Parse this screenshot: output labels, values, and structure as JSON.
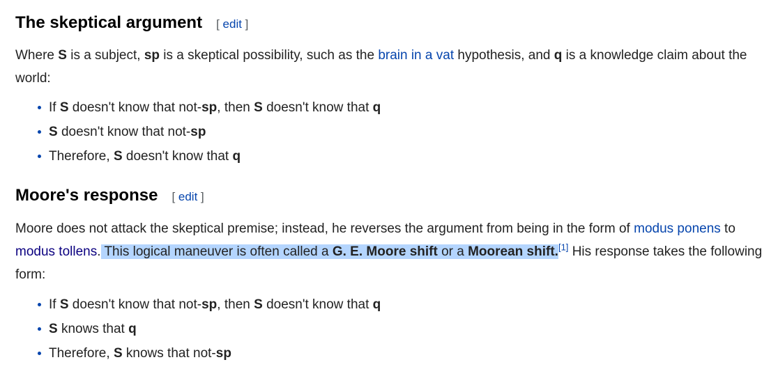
{
  "section1": {
    "heading": "The skeptical argument",
    "edit_open": "[ ",
    "edit_label": "edit",
    "edit_close": " ]",
    "para": {
      "t1": "Where ",
      "S": "S",
      "t2": " is a subject, ",
      "sp": "sp",
      "t3": " is a skeptical possibility, such as the ",
      "link": "brain in a vat",
      "t4": " hypothesis, and ",
      "q": "q",
      "t5": " is a knowledge claim about the world:"
    },
    "bullets": [
      {
        "a": "If ",
        "b1": "S",
        "c": " doesn't know that not-",
        "b2": "sp",
        "d": ", then ",
        "b3": "S",
        "e": " doesn't know that ",
        "b4": "q"
      },
      {
        "b1": "S",
        "c": " doesn't know that not-",
        "b2": "sp"
      },
      {
        "a": "Therefore, ",
        "b1": "S",
        "c": " doesn't know that ",
        "b2": "q"
      }
    ]
  },
  "section2": {
    "heading": "Moore's response",
    "edit_open": "[ ",
    "edit_label": "edit",
    "edit_close": " ]",
    "para": {
      "t1": "Moore does not attack the skeptical premise; instead, he reverses the argument from being in the form of ",
      "link1": "modus ponens",
      "t2": " to ",
      "link2": "modus tollens",
      "t3": ".",
      "h1": " This logical maneuver is often called a ",
      "hb1": "G. E. Moore shift",
      "h2": " or a ",
      "hb2": "Moorean shift.",
      "ref": "[1]",
      "t4": " His response takes the following form:"
    },
    "bullets": [
      {
        "a": "If ",
        "b1": "S",
        "c": " doesn't know that not-",
        "b2": "sp",
        "d": ", then ",
        "b3": "S",
        "e": " doesn't know that ",
        "b4": "q"
      },
      {
        "b1": "S",
        "c": " knows that ",
        "b2": "q"
      },
      {
        "a": "Therefore, ",
        "b1": "S",
        "c": " knows that not-",
        "b2": "sp"
      }
    ]
  },
  "colors": {
    "link": "#0645ad",
    "visited_link": "#0b0080",
    "highlight": "#b4d5fe"
  }
}
